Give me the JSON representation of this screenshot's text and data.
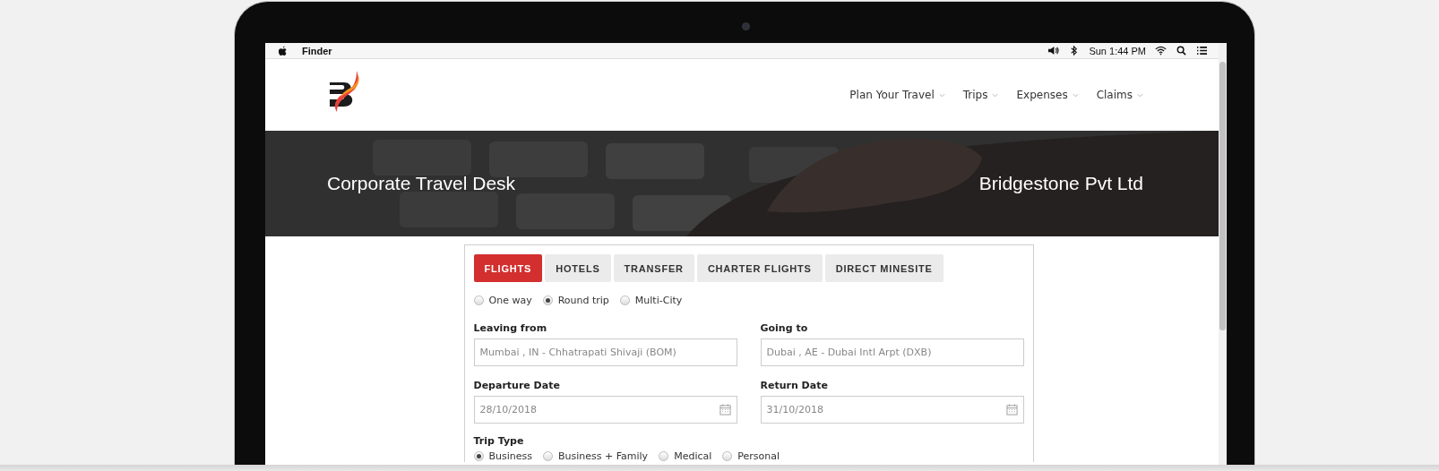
{
  "menu_bar": {
    "app": "Finder",
    "clock": "Sun 1:44 PM"
  },
  "nav": [
    "Plan Your Travel",
    "Trips",
    "Expenses",
    "Claims"
  ],
  "banner": {
    "title": "Corporate Travel Desk",
    "company": "Bridgestone Pvt Ltd"
  },
  "tabs": [
    {
      "label": "FLIGHTS",
      "selected": true
    },
    {
      "label": "HOTELS",
      "selected": false
    },
    {
      "label": "TRANSFER",
      "selected": false
    },
    {
      "label": "CHARTER FLIGHTS",
      "selected": false
    },
    {
      "label": "DIRECT MINESITE",
      "selected": false
    }
  ],
  "trip_modes": [
    {
      "label": "One way",
      "selected": false
    },
    {
      "label": "Round trip",
      "selected": true
    },
    {
      "label": "Multi-City",
      "selected": false
    }
  ],
  "fields": [
    {
      "label": "Leaving from",
      "value": "Mumbai , IN - Chhatrapati Shivaji (BOM)",
      "kind": "text"
    },
    {
      "label": "Going to",
      "value": "Dubai , AE - Dubai Intl Arpt (DXB)",
      "kind": "text"
    },
    {
      "label": "Departure Date",
      "value": "28/10/2018",
      "kind": "date"
    },
    {
      "label": "Return Date",
      "value": "31/10/2018",
      "kind": "date"
    }
  ],
  "trip_type": {
    "label": "Trip Type",
    "options": [
      {
        "label": "Business",
        "selected": true
      },
      {
        "label": "Business + Family",
        "selected": false
      },
      {
        "label": "Medical",
        "selected": false
      },
      {
        "label": "Personal",
        "selected": false
      }
    ]
  }
}
